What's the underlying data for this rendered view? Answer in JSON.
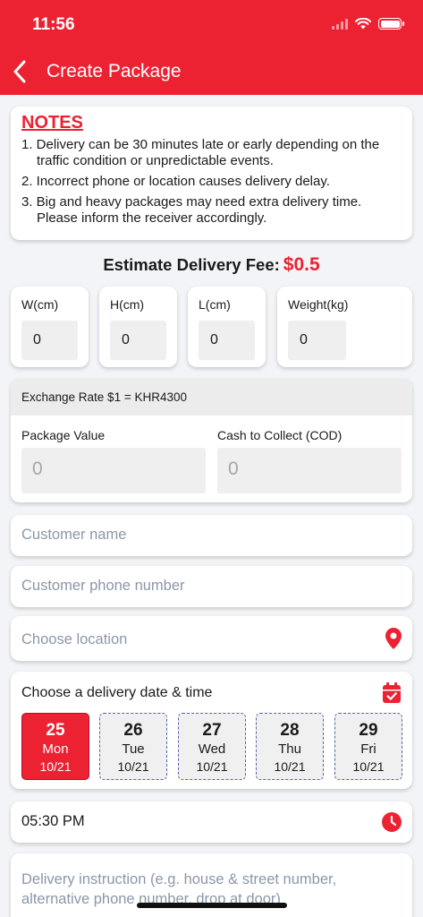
{
  "status": {
    "time": "11:56"
  },
  "header": {
    "title": "Create Package"
  },
  "notes": {
    "title": "NOTES",
    "items": [
      "1. Delivery can be 30 minutes late or early depending on the traffic condition or unpredictable events.",
      "2. Incorrect phone or location causes delivery delay.",
      "3. Big and heavy packages may need extra delivery time. Please inform the receiver accordingly."
    ]
  },
  "fee": {
    "label": "Estimate Delivery Fee:",
    "amount": "$0.5"
  },
  "dimensions": [
    {
      "label": "W(cm)",
      "value": "0"
    },
    {
      "label": "H(cm)",
      "value": "0"
    },
    {
      "label": "L(cm)",
      "value": "0"
    },
    {
      "label": "Weight(kg)",
      "value": "0"
    }
  ],
  "money": {
    "exchange_rate": "Exchange Rate $1 = KHR4300",
    "package_value_label": "Package Value",
    "package_value_placeholder": "0",
    "cod_label": "Cash to Collect (COD)",
    "cod_placeholder": "0"
  },
  "customer": {
    "name_placeholder": "Customer name",
    "phone_placeholder": "Customer phone number",
    "location_placeholder": "Choose location"
  },
  "delivery": {
    "date_title": "Choose a delivery date & time",
    "days": [
      {
        "num": "25",
        "dow": "Mon",
        "date": "10/21",
        "selected": true
      },
      {
        "num": "26",
        "dow": "Tue",
        "date": "10/21",
        "selected": false
      },
      {
        "num": "27",
        "dow": "Wed",
        "date": "10/21",
        "selected": false
      },
      {
        "num": "28",
        "dow": "Thu",
        "date": "10/21",
        "selected": false
      },
      {
        "num": "29",
        "dow": "Fri",
        "date": "10/21",
        "selected": false
      }
    ],
    "time": "05:30 PM",
    "instruction_placeholder": "Delivery instruction (e.g. house & street number, alternative phone number, drop at door)"
  },
  "colors": {
    "brand": "#ec2233",
    "date_border": "#5663a4",
    "placeholder": "#8c97a8"
  },
  "icons": [
    "back-chevron-icon",
    "location-pin-icon",
    "calendar-check-icon",
    "clock-icon"
  ]
}
